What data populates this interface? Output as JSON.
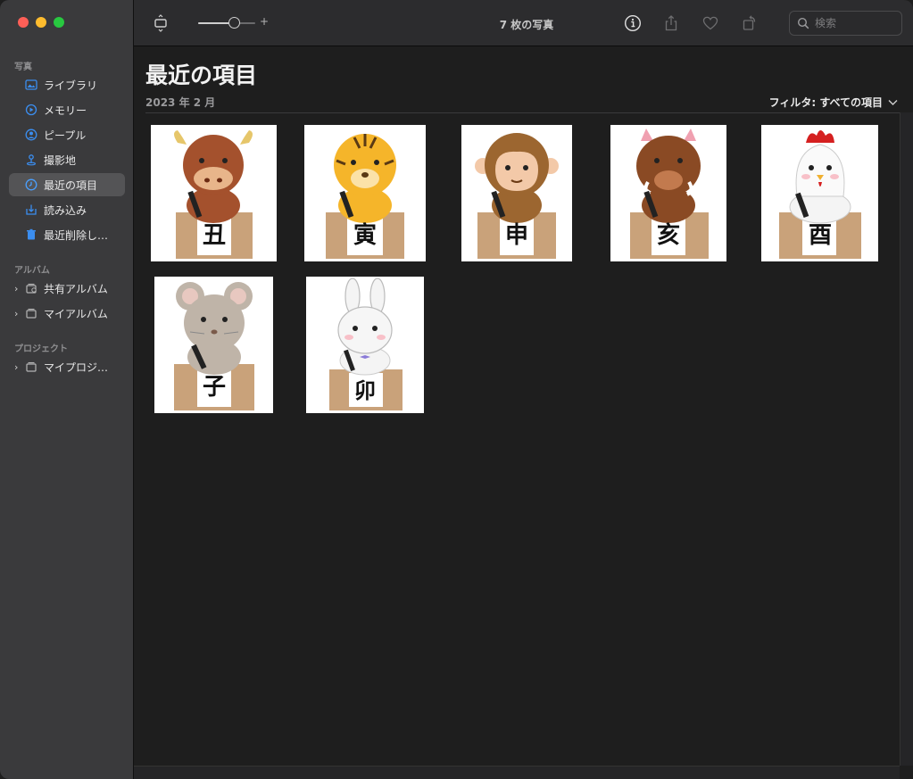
{
  "toolbar": {
    "title": "7 枚の写真",
    "zoom_plus": "+",
    "search_placeholder": "検索"
  },
  "sidebar": {
    "sections": [
      {
        "label": "写真"
      },
      {
        "label": "アルバム"
      },
      {
        "label": "プロジェクト"
      }
    ],
    "photos_items": [
      {
        "label": "ライブラリ",
        "icon": "library-icon"
      },
      {
        "label": "メモリー",
        "icon": "memories-icon"
      },
      {
        "label": "ピープル",
        "icon": "people-icon"
      },
      {
        "label": "撮影地",
        "icon": "places-icon"
      },
      {
        "label": "最近の項目",
        "icon": "recents-icon"
      },
      {
        "label": "読み込み",
        "icon": "imports-icon"
      },
      {
        "label": "最近削除し…",
        "icon": "trash-icon"
      }
    ],
    "album_items": [
      {
        "label": "共有アルバム",
        "icon": "shared-album-icon"
      },
      {
        "label": "マイアルバム",
        "icon": "album-icon"
      }
    ],
    "project_items": [
      {
        "label": "マイプロジ…",
        "icon": "project-icon"
      }
    ],
    "selected": "最近の項目"
  },
  "main": {
    "title": "最近の項目",
    "date": "2023 年 2 月",
    "filter_label": "フィルタ: すべての項目"
  },
  "photos": [
    {
      "animal": "ox",
      "character": "丑"
    },
    {
      "animal": "tiger",
      "character": "寅"
    },
    {
      "animal": "monkey",
      "character": "申"
    },
    {
      "animal": "boar",
      "character": "亥"
    },
    {
      "animal": "rooster",
      "character": "酉"
    },
    {
      "animal": "rat",
      "character": "子"
    },
    {
      "animal": "rabbit",
      "character": "卯"
    }
  ],
  "colors": {
    "accent": "#3b8ef0",
    "trash": "#3b8ef0"
  }
}
